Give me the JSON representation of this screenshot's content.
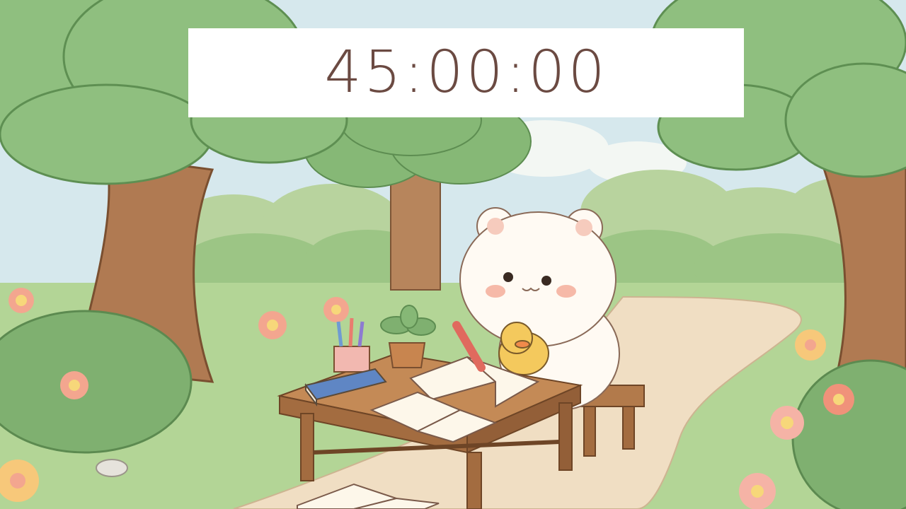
{
  "timer": {
    "display": "45:00:00"
  },
  "scene": {
    "theme": "cozy-forest-study",
    "colors": {
      "sky": "#cfe3ea",
      "foliage": "#8fbf7f",
      "foliage_dark": "#6fa465",
      "trunk": "#b07a52",
      "grass": "#a9cf8c",
      "path": "#efdcc0",
      "table": "#b27a4b",
      "bear": "#fffaf3",
      "timer_text": "#6b4a42",
      "timer_bg": "#ffffff"
    }
  }
}
